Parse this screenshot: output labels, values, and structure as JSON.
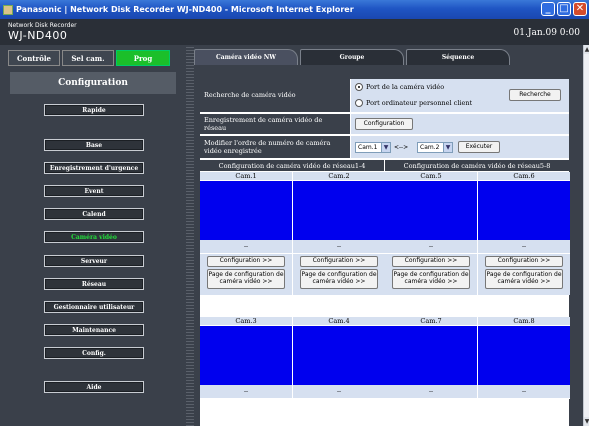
{
  "window": {
    "title": "Panasonic | Network Disk Recorder WJ-ND400 - Microsoft Internet Explorer"
  },
  "header": {
    "subtitle": "Network Disk Recorder",
    "model": "WJ-ND400",
    "datetime": "01.Jan.09  0:00"
  },
  "topnav": [
    {
      "label": "Contrôle"
    },
    {
      "label": "Sel cam."
    },
    {
      "label": "Prog"
    }
  ],
  "sidebar": {
    "title": "Configuration",
    "items": [
      {
        "label": "Rapide"
      },
      {
        "label": "Base"
      },
      {
        "label": "Enregistrement d'urgence"
      },
      {
        "label": "Event"
      },
      {
        "label": "Calend"
      },
      {
        "label": "Caméra vidéo"
      },
      {
        "label": "Serveur"
      },
      {
        "label": "Réseau"
      },
      {
        "label": "Gestionnaire utilisateur"
      },
      {
        "label": "Maintenance"
      },
      {
        "label": "Config."
      },
      {
        "label": "Aide"
      }
    ]
  },
  "tabs": [
    {
      "label": "Caméra vidéo NW"
    },
    {
      "label": "Groupe"
    },
    {
      "label": "Séquence"
    }
  ],
  "settings": {
    "search_label": "Recherche de caméra vidéo",
    "radio1": "Port de la caméra vidéo",
    "radio2": "Port ordinateur personnel client",
    "search_button": "Recherche",
    "register_label": "Enregistrement de caméra vidéo de réseau",
    "register_button": "Configuration",
    "order_label": "Modifier l'ordre de numéro de caméra vidéo enregistrée",
    "order_from": "Cam.1",
    "order_sep": "<-->",
    "order_to": "Cam.2",
    "execute_button": "Exécuter"
  },
  "groups": [
    {
      "label": "Configuration de caméra vidéo de réseau1-4"
    },
    {
      "label": "Configuration de caméra vidéo de réseau5-8"
    }
  ],
  "cams_row1": [
    {
      "name": "Cam.1",
      "dash": "--",
      "config": "Configuration >>",
      "page": "Page de configuration de caméra vidéo >>"
    },
    {
      "name": "Cam.2",
      "dash": "--",
      "config": "Configuration >>",
      "page": "Page de configuration de caméra vidéo >>"
    },
    {
      "name": "Cam.5",
      "dash": "--",
      "config": "Configuration >>",
      "page": "Page de configuration de caméra vidéo >>"
    },
    {
      "name": "Cam.6",
      "dash": "--",
      "config": "Configuration >>",
      "page": "Page de configuration de caméra vidéo >>"
    }
  ],
  "cams_row2": [
    {
      "name": "Cam.3",
      "dash": "--"
    },
    {
      "name": "Cam.4",
      "dash": "--"
    },
    {
      "name": "Cam.7",
      "dash": "--"
    },
    {
      "name": "Cam.8",
      "dash": "--"
    }
  ]
}
